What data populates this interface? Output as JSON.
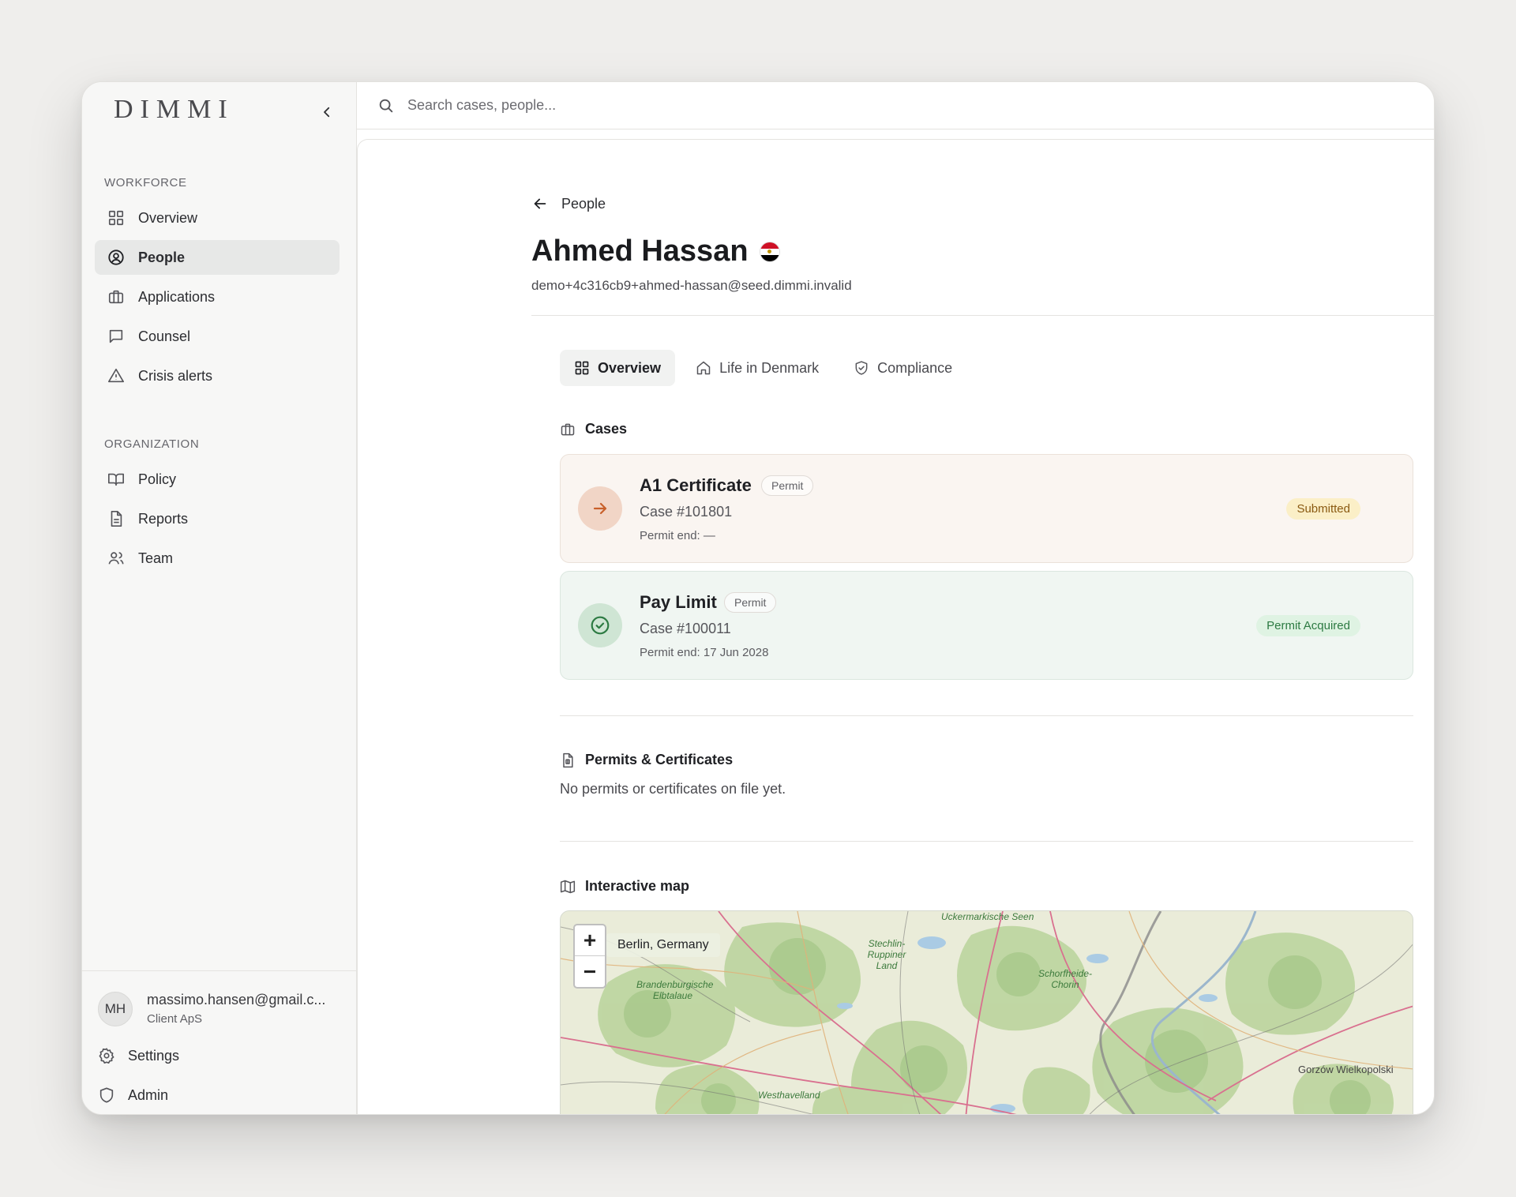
{
  "app": {
    "logo": "DIMMI"
  },
  "sidebar": {
    "workforce_label": "WORKFORCE",
    "workforce_items": [
      {
        "label": "Overview",
        "icon": "grid-icon"
      },
      {
        "label": "People",
        "icon": "user-circle-icon",
        "active": true
      },
      {
        "label": "Applications",
        "icon": "briefcase-icon"
      },
      {
        "label": "Counsel",
        "icon": "chat-icon"
      },
      {
        "label": "Crisis alerts",
        "icon": "warning-icon"
      }
    ],
    "organization_label": "ORGANIZATION",
    "organization_items": [
      {
        "label": "Policy",
        "icon": "book-icon"
      },
      {
        "label": "Reports",
        "icon": "document-icon"
      },
      {
        "label": "Team",
        "icon": "users-icon"
      }
    ],
    "user": {
      "initials": "MH",
      "email": "massimo.hansen@gmail.c...",
      "org": "Client ApS"
    },
    "footer_items": [
      {
        "label": "Settings",
        "icon": "gear-icon"
      },
      {
        "label": "Admin",
        "icon": "shield-icon"
      }
    ]
  },
  "search": {
    "placeholder": "Search cases, people..."
  },
  "main": {
    "back_label": "People",
    "person": {
      "name": "Ahmed Hassan",
      "email": "demo+4c316cb9+ahmed-hassan@seed.dimmi.invalid",
      "flag": "egypt-flag-icon"
    },
    "tabs": [
      {
        "label": "Overview",
        "icon": "grid-icon",
        "active": true
      },
      {
        "label": "Life in Denmark",
        "icon": "home-icon"
      },
      {
        "label": "Compliance",
        "icon": "shield-check-icon"
      }
    ],
    "cases_heading": "Cases",
    "cases": [
      {
        "title": "A1 Certificate",
        "type": "Permit",
        "number": "Case #101801",
        "end": "Permit end: —",
        "status": "Submitted",
        "icon": "arrow-right-icon"
      },
      {
        "title": "Pay Limit",
        "type": "Permit",
        "number": "Case #100011",
        "end": "Permit end: 17 Jun 2028",
        "status": "Permit Acquired",
        "icon": "check-circle-icon"
      }
    ],
    "permits_heading": "Permits & Certificates",
    "permits_empty": "No permits or certificates on file yet.",
    "map_heading": "Interactive map",
    "map": {
      "location_label": "Berlin, Germany",
      "zoom_in": "+",
      "zoom_out": "−",
      "places": {
        "p1": "Uckermarkische Seen",
        "p2": "Stechlin-Ruppiner Land",
        "p3": "Schorfheide-Chorin",
        "p4": "Brandenburgische Elbtalaue",
        "p5": "Westhavelland",
        "p6": "Gorzów Wielkopolski"
      }
    }
  },
  "colors": {
    "accent_orange": "#c8602b",
    "accent_green": "#2c7a42",
    "sidebar_bg": "#f7f7f6"
  }
}
